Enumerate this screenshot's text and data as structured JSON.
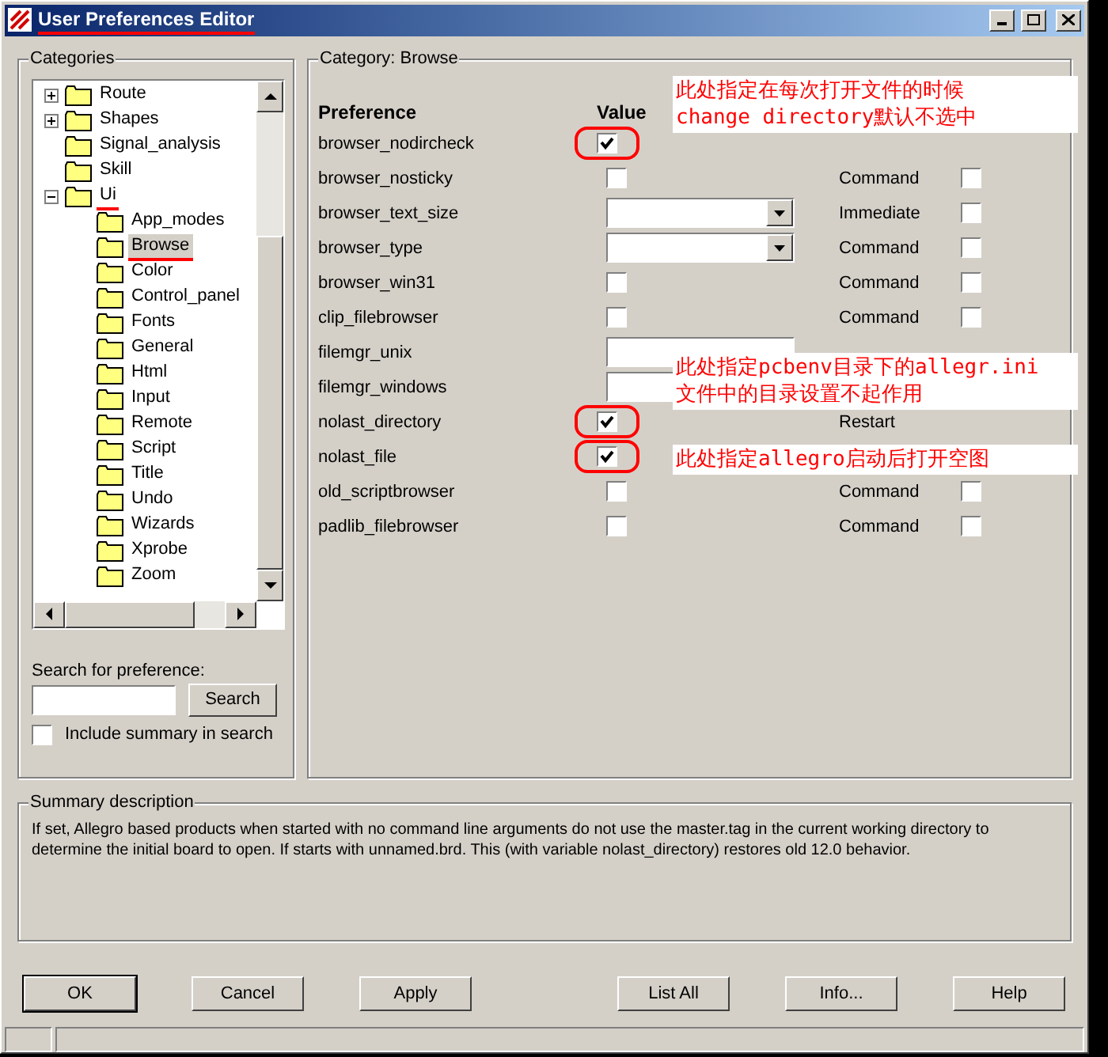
{
  "window": {
    "title": "User Preferences Editor",
    "underlined": true
  },
  "categories": {
    "label": "Categories",
    "tree": [
      {
        "label": "Route",
        "expanded": false,
        "selected": false,
        "underlined": false
      },
      {
        "label": "Shapes",
        "expanded": false,
        "selected": false,
        "underlined": false
      },
      {
        "label": "Signal_analysis",
        "selected": false,
        "underlined": false
      },
      {
        "label": "Skill",
        "selected": false,
        "underlined": false
      },
      {
        "label": "Ui",
        "expanded": true,
        "selected": false,
        "underlined": true,
        "children": [
          {
            "label": "App_modes",
            "selected": false,
            "underlined": false
          },
          {
            "label": "Browse",
            "selected": true,
            "underlined": true
          },
          {
            "label": "Color",
            "selected": false,
            "underlined": false
          },
          {
            "label": "Control_panel",
            "selected": false,
            "underlined": false
          },
          {
            "label": "Fonts",
            "selected": false,
            "underlined": false
          },
          {
            "label": "General",
            "selected": false,
            "underlined": false
          },
          {
            "label": "Html",
            "selected": false,
            "underlined": false
          },
          {
            "label": "Input",
            "selected": false,
            "underlined": false
          },
          {
            "label": "Remote",
            "selected": false,
            "underlined": false
          },
          {
            "label": "Script",
            "selected": false,
            "underlined": false
          },
          {
            "label": "Title",
            "selected": false,
            "underlined": false
          },
          {
            "label": "Undo",
            "selected": false,
            "underlined": false
          },
          {
            "label": "Wizards",
            "selected": false,
            "underlined": false
          },
          {
            "label": "Xprobe",
            "selected": false,
            "underlined": false
          },
          {
            "label": "Zoom",
            "selected": false,
            "underlined": false
          }
        ]
      }
    ],
    "search_label": "Search for preference:",
    "search_button": "Search",
    "include_summary": {
      "label": "Include summary in search",
      "checked": false
    }
  },
  "category": {
    "label": "Category:",
    "value": "Browse",
    "columns": [
      "Preference",
      "Value"
    ],
    "rows": [
      {
        "name": "browser_nodircheck",
        "kind": "checkbox",
        "checked": true,
        "circled": true,
        "note": {
          "kind": "above",
          "lines": [
            "此处指定在每次打开文件的时候",
            "change directory默认不选中"
          ]
        }
      },
      {
        "name": "browser_nosticky",
        "kind": "checkbox",
        "checked": false,
        "circled": false,
        "mode": "Command",
        "mode_checked": false
      },
      {
        "name": "browser_text_size",
        "kind": "combo",
        "circled": false,
        "mode": "Immediate",
        "mode_checked": false
      },
      {
        "name": "browser_type",
        "kind": "combo",
        "circled": false,
        "mode": "Command",
        "mode_checked": false
      },
      {
        "name": "browser_win31",
        "kind": "checkbox",
        "checked": false,
        "circled": false,
        "mode": "Command",
        "mode_checked": false
      },
      {
        "name": "clip_filebrowser",
        "kind": "checkbox",
        "checked": false,
        "circled": false,
        "mode": "Command",
        "mode_checked": false
      },
      {
        "name": "filemgr_unix",
        "kind": "text",
        "circled": false,
        "note": {
          "kind": "below",
          "lines": [
            "此处指定pcbenv目录下的allegr.ini",
            "文件中的目录设置不起作用"
          ]
        }
      },
      {
        "name": "filemgr_windows",
        "kind": "text",
        "circled": false
      },
      {
        "name": "nolast_directory",
        "kind": "checkbox",
        "checked": true,
        "circled": true,
        "mode": "Restart"
      },
      {
        "name": "nolast_file",
        "kind": "checkbox",
        "checked": true,
        "circled": true,
        "note": {
          "kind": "beside",
          "lines": [
            "此处指定allegro启动后打开空图"
          ]
        }
      },
      {
        "name": "old_scriptbrowser",
        "kind": "checkbox",
        "checked": false,
        "circled": false,
        "mode": "Command",
        "mode_checked": false
      },
      {
        "name": "padlib_filebrowser",
        "kind": "checkbox",
        "checked": false,
        "circled": false,
        "mode": "Command",
        "mode_checked": false
      }
    ]
  },
  "summary": {
    "label": "Summary description",
    "text": "If set, Allegro based products when started with no command line arguments do not use the master.tag in the current working directory to determine the initial board to open. If starts with unnamed.brd. This (with variable nolast_directory) restores old 12.0 behavior."
  },
  "buttons": [
    "OK",
    "Cancel",
    "Apply",
    "List All",
    "Info...",
    "Help"
  ]
}
